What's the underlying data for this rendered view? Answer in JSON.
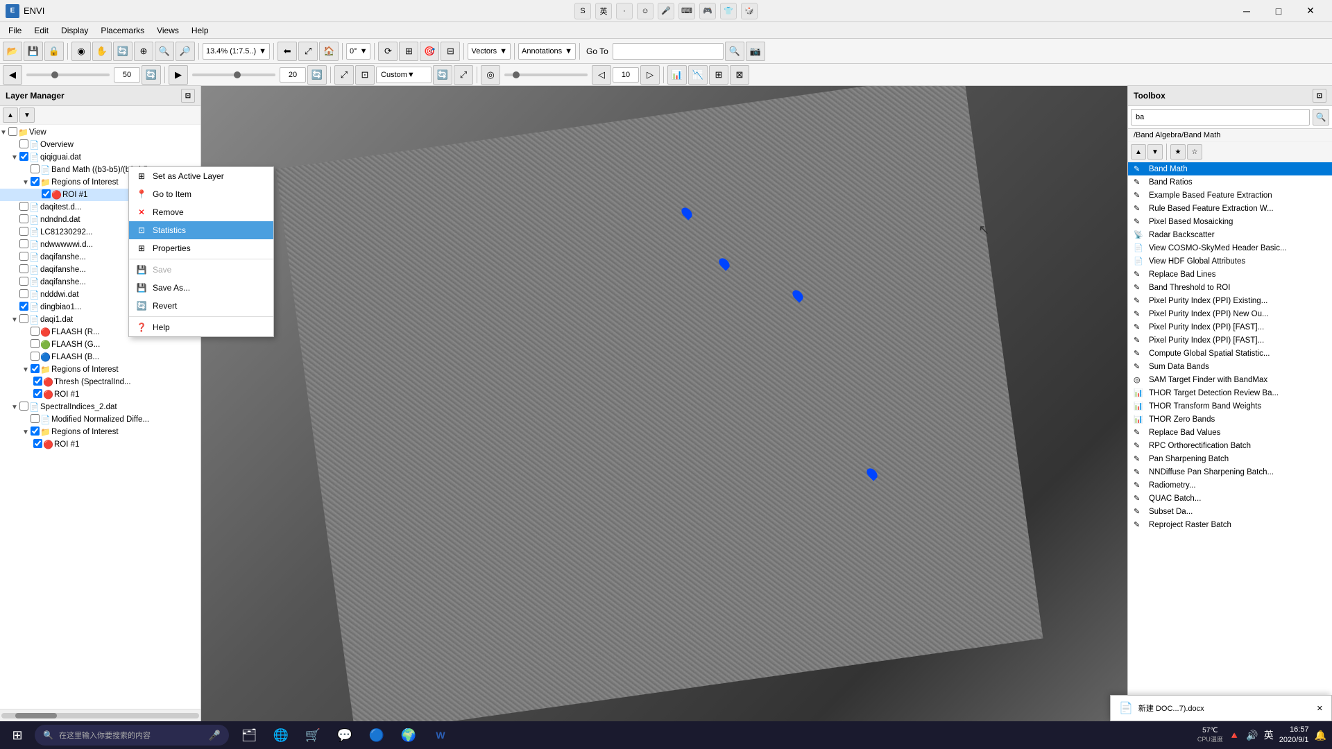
{
  "app": {
    "title": "ENVI",
    "icon": "E"
  },
  "title_bar": {
    "controls": {
      "minimize": "─",
      "maximize": "□",
      "close": "✕"
    }
  },
  "title_icons": [
    "S",
    "英",
    "·",
    "☺",
    "🎤",
    "⌨",
    "🎮",
    "👕",
    "🎲"
  ],
  "menu": {
    "items": [
      "File",
      "Edit",
      "Display",
      "Placemarks",
      "Views",
      "Help"
    ]
  },
  "toolbar1": {
    "buttons": [
      "📂",
      "💾",
      "🔒",
      "◉",
      "✋",
      "🔄",
      "⊕",
      "🔍",
      "🔎",
      "➕"
    ],
    "zoom_value": "13.4% (1:7.5..)",
    "rotation_value": "0°",
    "goto_label": "Go To",
    "goto_placeholder": "",
    "camera_icon": "📷"
  },
  "toolbar2": {
    "slider_value": "50",
    "refresh_icon": "🔄",
    "zoom_value": "20",
    "refresh2_icon": "🔄",
    "custom_label": "Custom",
    "sync_icon": "🔄",
    "stretch_icon": "⤢",
    "opacity_icon": "◎",
    "opacity_value": "10",
    "icons_right": [
      "📊",
      "📉",
      "⊞",
      "⊠"
    ]
  },
  "layer_manager": {
    "title": "Layer Manager",
    "items": [
      {
        "id": "view",
        "label": "View",
        "level": 0,
        "expanded": true,
        "type": "folder",
        "checked": false
      },
      {
        "id": "overview",
        "label": "Overview",
        "level": 1,
        "type": "file",
        "checked": false
      },
      {
        "id": "qiqiguai",
        "label": "qiqiguai.dat",
        "level": 1,
        "type": "file",
        "checked": true
      },
      {
        "id": "bandmath",
        "label": "Band Math ((b3-b5)/(b3+b5",
        "level": 2,
        "type": "bandmath",
        "checked": false
      },
      {
        "id": "roi_group1",
        "label": "Regions of Interest",
        "level": 2,
        "type": "folder",
        "checked": true,
        "expanded": true
      },
      {
        "id": "roi1_item",
        "label": "ROI #1",
        "level": 4,
        "type": "roi",
        "checked": true,
        "selected": true
      },
      {
        "id": "daqitest",
        "label": "daqitest.d...",
        "level": 1,
        "type": "file",
        "checked": false
      },
      {
        "id": "ndndnd",
        "label": "ndndnd.dat",
        "level": 1,
        "type": "file",
        "checked": false
      },
      {
        "id": "LC81230292",
        "label": "LC81230292...",
        "level": 1,
        "type": "file",
        "checked": false
      },
      {
        "id": "ndwwwwwi",
        "label": "ndwwwwwi.d...",
        "level": 1,
        "type": "file",
        "checked": false
      },
      {
        "id": "daqifanshe1",
        "label": "daqifanshe...",
        "level": 1,
        "type": "file",
        "checked": false
      },
      {
        "id": "daqifanshe2",
        "label": "daqifanshe...",
        "level": 1,
        "type": "file",
        "checked": false
      },
      {
        "id": "daqifanshe3",
        "label": "daqifanshe...",
        "level": 1,
        "type": "file",
        "checked": false
      },
      {
        "id": "ndddwi",
        "label": "ndddwi.dat",
        "level": 1,
        "type": "file",
        "checked": false
      },
      {
        "id": "dingbiao1",
        "label": "dingbiao1...",
        "level": 1,
        "type": "file",
        "checked": true
      },
      {
        "id": "daqi1",
        "label": "daqi1.dat",
        "level": 1,
        "type": "file",
        "checked": false
      },
      {
        "id": "flaash_r",
        "label": "FLAASH (R...",
        "level": 2,
        "type": "roi_r",
        "checked": false
      },
      {
        "id": "flaash_g",
        "label": "FLAASH (G...",
        "level": 2,
        "type": "roi_g",
        "checked": false
      },
      {
        "id": "flaash_b",
        "label": "FLAASH (B...",
        "level": 2,
        "type": "roi_b",
        "checked": false
      },
      {
        "id": "roi_group2",
        "label": "Regions of Interest",
        "level": 2,
        "type": "folder",
        "checked": true,
        "expanded": true
      },
      {
        "id": "thresh",
        "label": "Thresh (SpectralInd...",
        "level": 3,
        "type": "roi",
        "checked": true
      },
      {
        "id": "roi2_item",
        "label": "ROI #1",
        "level": 3,
        "type": "roi",
        "checked": true
      },
      {
        "id": "spectral_indices",
        "label": "SpectralIndices_2.dat",
        "level": 1,
        "type": "file",
        "checked": false
      },
      {
        "id": "mod_norm_diff",
        "label": "Modified Normalized Diffe...",
        "level": 2,
        "type": "bandmath",
        "checked": false
      },
      {
        "id": "roi_group3",
        "label": "Regions of Interest",
        "level": 2,
        "type": "folder",
        "checked": true,
        "expanded": true
      },
      {
        "id": "roi3_item",
        "label": "ROI #1",
        "level": 3,
        "type": "roi",
        "checked": true
      }
    ]
  },
  "context_menu": {
    "items": [
      {
        "id": "set_active",
        "label": "Set as Active Layer",
        "icon": "layer",
        "type": "normal"
      },
      {
        "id": "goto_item",
        "label": "Go to Item",
        "icon": "pin",
        "type": "normal"
      },
      {
        "id": "remove",
        "label": "Remove",
        "icon": "x",
        "type": "normal"
      },
      {
        "id": "statistics",
        "label": "Statistics",
        "icon": "stats",
        "type": "highlighted"
      },
      {
        "id": "properties",
        "label": "Properties",
        "icon": "props",
        "type": "normal"
      },
      {
        "id": "sep1",
        "type": "separator"
      },
      {
        "id": "save",
        "label": "Save",
        "icon": "save",
        "type": "disabled"
      },
      {
        "id": "save_as",
        "label": "Save As...",
        "icon": "save_as",
        "type": "normal"
      },
      {
        "id": "revert",
        "label": "Revert",
        "icon": "revert",
        "type": "normal"
      },
      {
        "id": "sep2",
        "type": "separator"
      },
      {
        "id": "help",
        "label": "Help",
        "icon": "help",
        "type": "normal"
      }
    ]
  },
  "toolbox": {
    "title": "Toolbox",
    "search_value": "ba",
    "search_placeholder": "ba",
    "path": "/Band Algebra/Band Math",
    "items": [
      {
        "id": "band_math",
        "label": "Band Math",
        "icon": "✎",
        "active": true
      },
      {
        "id": "band_ratios",
        "label": "Band Ratios",
        "icon": "✎"
      },
      {
        "id": "example_feature",
        "label": "Example Based Feature Extraction",
        "icon": "✎"
      },
      {
        "id": "rule_feature",
        "label": "Rule Based Feature Extraction W...",
        "icon": "✎"
      },
      {
        "id": "pixel_mosaicking",
        "label": "Pixel Based Mosaicking",
        "icon": "✎"
      },
      {
        "id": "radar_backscatter",
        "label": "Radar Backscatter",
        "icon": "📡"
      },
      {
        "id": "view_cosmo",
        "label": "View COSMO-SkyMed Header Basic...",
        "icon": "📄"
      },
      {
        "id": "view_hdf",
        "label": "View HDF Global Attributes",
        "icon": "📄"
      },
      {
        "id": "replace_bad_lines",
        "label": "Replace Bad Lines",
        "icon": "✎"
      },
      {
        "id": "band_threshold",
        "label": "Band Threshold to ROI",
        "icon": "✎"
      },
      {
        "id": "ppi_existing",
        "label": "Pixel Purity Index (PPI) Existing...",
        "icon": "✎"
      },
      {
        "id": "ppi_new",
        "label": "Pixel Purity Index (PPI) New Ou...",
        "icon": "✎"
      },
      {
        "id": "ppi_fast1",
        "label": "Pixel Purity Index (PPI) [FAST]...",
        "icon": "✎"
      },
      {
        "id": "ppi_fast2",
        "label": "Pixel Purity Index (PPI) [FAST]...",
        "icon": "✎"
      },
      {
        "id": "compute_global",
        "label": "Compute Global Spatial Statistic...",
        "icon": "✎"
      },
      {
        "id": "sum_data_bands",
        "label": "Sum Data Bands",
        "icon": "✎"
      },
      {
        "id": "sam_target",
        "label": "SAM Target Finder with BandMax",
        "icon": "◎"
      },
      {
        "id": "thor_target",
        "label": "THOR Target Detection Review Ba...",
        "icon": "📊"
      },
      {
        "id": "thor_transform",
        "label": "THOR Transform Band Weights",
        "icon": "📊"
      },
      {
        "id": "thor_zero",
        "label": "THOR Zero Bands",
        "icon": "📊"
      },
      {
        "id": "replace_bad_values",
        "label": "Replace Bad Values",
        "icon": "✎"
      },
      {
        "id": "rpc_ortho",
        "label": "RPC Orthorectification Batch",
        "icon": "✎"
      },
      {
        "id": "pan_sharpening",
        "label": "Pan Sharpening Batch",
        "icon": "✎"
      },
      {
        "id": "nndiffuse",
        "label": "NNDiffuse Pan Sharpening Batch...",
        "icon": "✎"
      },
      {
        "id": "radiometry",
        "label": "Radiometry...",
        "icon": "✎"
      },
      {
        "id": "quac_batch",
        "label": "QUAC Batch...",
        "icon": "✎"
      },
      {
        "id": "subset_data",
        "label": "Subset Da...",
        "icon": "✎"
      },
      {
        "id": "reproject_raster",
        "label": "Reproject Raster Batch",
        "icon": "✎"
      }
    ],
    "band_math_label": "Band Math",
    "band_ratios_label": "Band Ratios"
  },
  "map_markers": [
    {
      "x": 52,
      "y": 19
    },
    {
      "x": 56,
      "y": 27
    },
    {
      "x": 64,
      "y": 32
    },
    {
      "x": 72,
      "y": 60
    }
  ],
  "taskbar": {
    "search_placeholder": "在这里输入你要搜索的内容",
    "mic_icon": "🎤",
    "apps": [
      "⊞",
      "◯",
      "🗂",
      "🌐",
      "💬",
      "🔵",
      "🌍",
      "W"
    ],
    "sys_icons": [
      "🔺",
      "🔊",
      "英"
    ],
    "temperature": "57℃",
    "temp_label": "CPU温度",
    "time": "16:57",
    "date": "2020/9/1",
    "notification_icon": "🔔",
    "notification_msg": "新建 DOC...7).docx",
    "close_taskbar": "✕"
  }
}
